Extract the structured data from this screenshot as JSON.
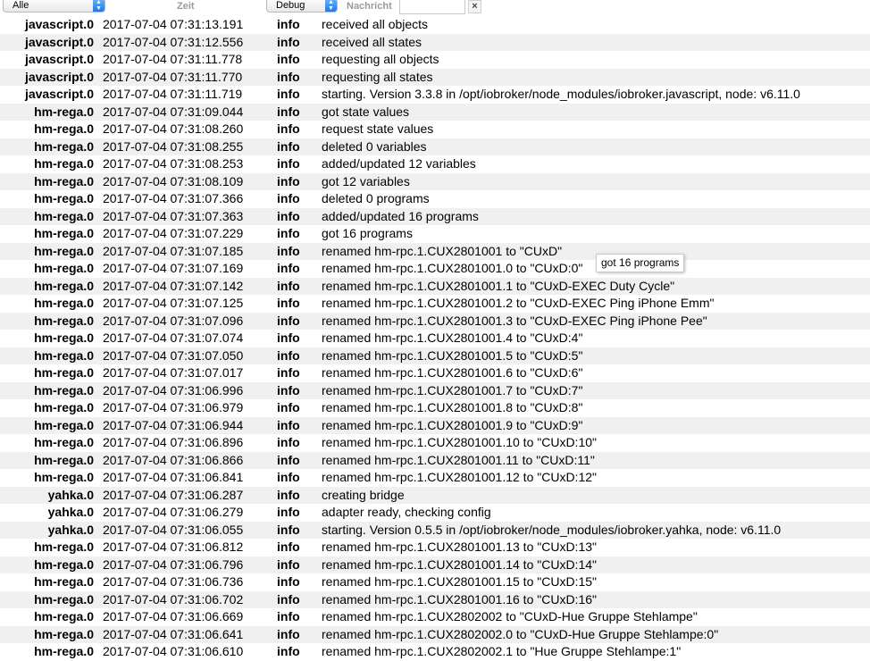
{
  "filters": {
    "source_select": "Alle",
    "time_header": "Zeit",
    "level_select": "Debug",
    "message_header": "Nachricht",
    "search_value": "",
    "clear_label": "×"
  },
  "tooltip": "got 16 programs",
  "rows": [
    {
      "src": "javascript.0",
      "time": "2017-07-04 07:31:13.191",
      "lvl": "info",
      "msg": "received all objects"
    },
    {
      "src": "javascript.0",
      "time": "2017-07-04 07:31:12.556",
      "lvl": "info",
      "msg": "received all states"
    },
    {
      "src": "javascript.0",
      "time": "2017-07-04 07:31:11.778",
      "lvl": "info",
      "msg": "requesting all objects"
    },
    {
      "src": "javascript.0",
      "time": "2017-07-04 07:31:11.770",
      "lvl": "info",
      "msg": "requesting all states"
    },
    {
      "src": "javascript.0",
      "time": "2017-07-04 07:31:11.719",
      "lvl": "info",
      "msg": "starting. Version 3.3.8 in /opt/iobroker/node_modules/iobroker.javascript, node: v6.11.0"
    },
    {
      "src": "hm-rega.0",
      "time": "2017-07-04 07:31:09.044",
      "lvl": "info",
      "msg": "got state values"
    },
    {
      "src": "hm-rega.0",
      "time": "2017-07-04 07:31:08.260",
      "lvl": "info",
      "msg": "request state values"
    },
    {
      "src": "hm-rega.0",
      "time": "2017-07-04 07:31:08.255",
      "lvl": "info",
      "msg": "deleted 0 variables"
    },
    {
      "src": "hm-rega.0",
      "time": "2017-07-04 07:31:08.253",
      "lvl": "info",
      "msg": "added/updated 12 variables"
    },
    {
      "src": "hm-rega.0",
      "time": "2017-07-04 07:31:08.109",
      "lvl": "info",
      "msg": "got 12 variables"
    },
    {
      "src": "hm-rega.0",
      "time": "2017-07-04 07:31:07.366",
      "lvl": "info",
      "msg": "deleted 0 programs"
    },
    {
      "src": "hm-rega.0",
      "time": "2017-07-04 07:31:07.363",
      "lvl": "info",
      "msg": "added/updated 16 programs"
    },
    {
      "src": "hm-rega.0",
      "time": "2017-07-04 07:31:07.229",
      "lvl": "info",
      "msg": "got 16 programs"
    },
    {
      "src": "hm-rega.0",
      "time": "2017-07-04 07:31:07.185",
      "lvl": "info",
      "msg": "renamed hm-rpc.1.CUX2801001 to \"CUxD\""
    },
    {
      "src": "hm-rega.0",
      "time": "2017-07-04 07:31:07.169",
      "lvl": "info",
      "msg": "renamed hm-rpc.1.CUX2801001.0 to \"CUxD:0\""
    },
    {
      "src": "hm-rega.0",
      "time": "2017-07-04 07:31:07.142",
      "lvl": "info",
      "msg": "renamed hm-rpc.1.CUX2801001.1 to \"CUxD-EXEC Duty Cycle\""
    },
    {
      "src": "hm-rega.0",
      "time": "2017-07-04 07:31:07.125",
      "lvl": "info",
      "msg": "renamed hm-rpc.1.CUX2801001.2 to \"CUxD-EXEC Ping iPhone Emm\""
    },
    {
      "src": "hm-rega.0",
      "time": "2017-07-04 07:31:07.096",
      "lvl": "info",
      "msg": "renamed hm-rpc.1.CUX2801001.3 to \"CUxD-EXEC Ping iPhone Pee\""
    },
    {
      "src": "hm-rega.0",
      "time": "2017-07-04 07:31:07.074",
      "lvl": "info",
      "msg": "renamed hm-rpc.1.CUX2801001.4 to \"CUxD:4\""
    },
    {
      "src": "hm-rega.0",
      "time": "2017-07-04 07:31:07.050",
      "lvl": "info",
      "msg": "renamed hm-rpc.1.CUX2801001.5 to \"CUxD:5\""
    },
    {
      "src": "hm-rega.0",
      "time": "2017-07-04 07:31:07.017",
      "lvl": "info",
      "msg": "renamed hm-rpc.1.CUX2801001.6 to \"CUxD:6\""
    },
    {
      "src": "hm-rega.0",
      "time": "2017-07-04 07:31:06.996",
      "lvl": "info",
      "msg": "renamed hm-rpc.1.CUX2801001.7 to \"CUxD:7\""
    },
    {
      "src": "hm-rega.0",
      "time": "2017-07-04 07:31:06.979",
      "lvl": "info",
      "msg": "renamed hm-rpc.1.CUX2801001.8 to \"CUxD:8\""
    },
    {
      "src": "hm-rega.0",
      "time": "2017-07-04 07:31:06.944",
      "lvl": "info",
      "msg": "renamed hm-rpc.1.CUX2801001.9 to \"CUxD:9\""
    },
    {
      "src": "hm-rega.0",
      "time": "2017-07-04 07:31:06.896",
      "lvl": "info",
      "msg": "renamed hm-rpc.1.CUX2801001.10 to \"CUxD:10\""
    },
    {
      "src": "hm-rega.0",
      "time": "2017-07-04 07:31:06.866",
      "lvl": "info",
      "msg": "renamed hm-rpc.1.CUX2801001.11 to \"CUxD:11\""
    },
    {
      "src": "hm-rega.0",
      "time": "2017-07-04 07:31:06.841",
      "lvl": "info",
      "msg": "renamed hm-rpc.1.CUX2801001.12 to \"CUxD:12\""
    },
    {
      "src": "yahka.0",
      "time": "2017-07-04 07:31:06.287",
      "lvl": "info",
      "msg": "creating bridge"
    },
    {
      "src": "yahka.0",
      "time": "2017-07-04 07:31:06.279",
      "lvl": "info",
      "msg": "adapter ready, checking config"
    },
    {
      "src": "yahka.0",
      "time": "2017-07-04 07:31:06.055",
      "lvl": "info",
      "msg": "starting. Version 0.5.5 in /opt/iobroker/node_modules/iobroker.yahka, node: v6.11.0"
    },
    {
      "src": "hm-rega.0",
      "time": "2017-07-04 07:31:06.812",
      "lvl": "info",
      "msg": "renamed hm-rpc.1.CUX2801001.13 to \"CUxD:13\""
    },
    {
      "src": "hm-rega.0",
      "time": "2017-07-04 07:31:06.796",
      "lvl": "info",
      "msg": "renamed hm-rpc.1.CUX2801001.14 to \"CUxD:14\""
    },
    {
      "src": "hm-rega.0",
      "time": "2017-07-04 07:31:06.736",
      "lvl": "info",
      "msg": "renamed hm-rpc.1.CUX2801001.15 to \"CUxD:15\""
    },
    {
      "src": "hm-rega.0",
      "time": "2017-07-04 07:31:06.702",
      "lvl": "info",
      "msg": "renamed hm-rpc.1.CUX2801001.16 to \"CUxD:16\""
    },
    {
      "src": "hm-rega.0",
      "time": "2017-07-04 07:31:06.669",
      "lvl": "info",
      "msg": "renamed hm-rpc.1.CUX2802002 to \"CUxD-Hue Gruppe Stehlampe\""
    },
    {
      "src": "hm-rega.0",
      "time": "2017-07-04 07:31:06.641",
      "lvl": "info",
      "msg": "renamed hm-rpc.1.CUX2802002.0 to \"CUxD-Hue Gruppe Stehlampe:0\""
    },
    {
      "src": "hm-rega.0",
      "time": "2017-07-04 07:31:06.610",
      "lvl": "info",
      "msg": "renamed hm-rpc.1.CUX2802002.1 to \"Hue Gruppe Stehlampe:1\""
    }
  ]
}
